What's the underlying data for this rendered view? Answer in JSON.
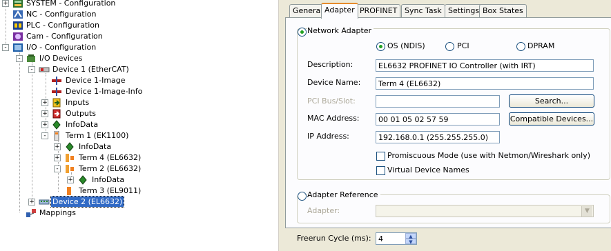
{
  "tree": {
    "items": [
      {
        "label": "SYSTEM - Configuration",
        "toggle": "+",
        "icon": "system-config-icon"
      },
      {
        "label": "NC - Configuration",
        "toggle": "",
        "icon": "nc-config-icon"
      },
      {
        "label": "PLC - Configuration",
        "toggle": "",
        "icon": "plc-config-icon"
      },
      {
        "label": "Cam - Configuration",
        "toggle": "",
        "icon": "cam-config-icon"
      },
      {
        "label": "I/O - Configuration",
        "toggle": "-",
        "icon": "io-config-icon"
      },
      {
        "label": "I/O Devices",
        "toggle": "-",
        "icon": "io-devices-icon"
      },
      {
        "label": "Device 1 (EtherCAT)",
        "toggle": "-",
        "icon": "ethercat-device-icon"
      },
      {
        "label": "Device 1-Image",
        "toggle": "",
        "icon": "process-image-icon"
      },
      {
        "label": "Device 1-Image-Info",
        "toggle": "",
        "icon": "process-image-icon"
      },
      {
        "label": "Inputs",
        "toggle": "+",
        "icon": "inputs-icon"
      },
      {
        "label": "Outputs",
        "toggle": "+",
        "icon": "outputs-icon"
      },
      {
        "label": "InfoData",
        "toggle": "+",
        "icon": "infodata-icon"
      },
      {
        "label": "Term 1 (EK1100)",
        "toggle": "-",
        "icon": "coupler-icon"
      },
      {
        "label": "InfoData",
        "toggle": "+",
        "icon": "infodata-icon"
      },
      {
        "label": "Term 4 (EL6632)",
        "toggle": "+",
        "icon": "terminal-icon"
      },
      {
        "label": "Term 2 (EL6632)",
        "toggle": "-",
        "icon": "terminal-icon"
      },
      {
        "label": "InfoData",
        "toggle": "+",
        "icon": "infodata-icon"
      },
      {
        "label": "Term 3 (EL9011)",
        "toggle": "",
        "icon": "end-terminal-icon"
      },
      {
        "label": "Device 2 (EL6632)",
        "toggle": "+",
        "icon": "profinet-device-icon",
        "selected": true
      },
      {
        "label": "Mappings",
        "toggle": "",
        "icon": "mappings-icon"
      }
    ]
  },
  "tabs": [
    "General",
    "Adapter",
    "PROFINET",
    "Sync Task",
    "Settings",
    "Box States"
  ],
  "active_tab": "Adapter",
  "adapter": {
    "network_adapter_label": "Network Adapter",
    "os_label": "OS (NDIS)",
    "pci_label": "PCI",
    "dpram_label": "DPRAM",
    "description_label": "Description:",
    "description_value": "EL6632 PROFINET IO Controller (with IRT)",
    "device_name_label": "Device Name:",
    "device_name_value": "Term 4 (EL6632)",
    "pci_bus_label": "PCI Bus/Slot:",
    "pci_bus_value": "",
    "search_button": "Search...",
    "mac_label": "MAC Address:",
    "mac_value": "00 01 05 02 57 59",
    "compatible_button": "Compatible Devices...",
    "ip_label": "IP Address:",
    "ip_value": "192.168.0.1 (255.255.255.0)",
    "promiscuous_label": "Promiscuous Mode (use with Netmon/Wireshark only)",
    "virtual_names_label": "Virtual Device Names",
    "adapter_reference_label": "Adapter Reference",
    "adapter_label": "Adapter:",
    "adapter_value": ""
  },
  "freerun": {
    "label": "Freerun Cycle (ms):",
    "value": "4"
  },
  "colors": {
    "selection": "#316ac5",
    "tab_highlight": "#e68b2c",
    "panel_bg": "#ece9d8"
  }
}
